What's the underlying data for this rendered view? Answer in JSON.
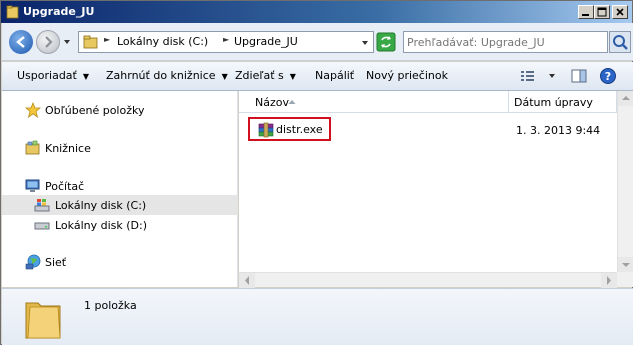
{
  "window": {
    "title": "Upgrade_JU",
    "minimize_icon": "minimize-icon",
    "maximize_icon": "maximize-icon",
    "close_icon": "close-icon"
  },
  "address_bar": {
    "back_icon": "back-arrow-icon",
    "forward_icon": "forward-arrow-icon",
    "path": [
      "Lokálny disk (C:)",
      "Upgrade_JU"
    ],
    "refresh_icon": "refresh-icon",
    "search_placeholder": "Prehľadávať: Upgrade_JU",
    "search_icon": "search-icon"
  },
  "toolbar": {
    "organize": "Usporiadať",
    "include_in_library": "Zahrnúť do knižnice",
    "share_with": "Zdieľať s",
    "burn": "Napáliť",
    "new_folder": "Nový priečinok",
    "views_icon": "views-icon",
    "preview_pane_icon": "preview-pane-icon",
    "help_icon": "help-icon"
  },
  "navigation": {
    "items": [
      {
        "label": "Obľúbené položky",
        "icon": "star-icon"
      },
      {
        "label": "Knižnice",
        "icon": "libraries-icon"
      },
      {
        "label": "Počítač",
        "icon": "computer-icon"
      },
      {
        "label": "Lokálny disk (C:)",
        "icon": "windows-drive-icon",
        "selected": true
      },
      {
        "label": "Lokálny disk (D:)",
        "icon": "drive-icon"
      },
      {
        "label": "Sieť",
        "icon": "network-icon"
      }
    ]
  },
  "file_list": {
    "columns": [
      "Názov",
      "Dátum úpravy"
    ],
    "rows": [
      {
        "name": "distr.exe",
        "date_modified": "1. 3. 2013 9:44",
        "icon": "winrar-archive-icon"
      }
    ]
  },
  "details_pane": {
    "count": "1 položka",
    "icon": "folder-icon"
  },
  "colors": {
    "title_bar_start": "#0a246a",
    "title_bar_end": "#a6caf0",
    "highlight_box": "#d0101c",
    "selected_nav": "#e5e5e5"
  }
}
